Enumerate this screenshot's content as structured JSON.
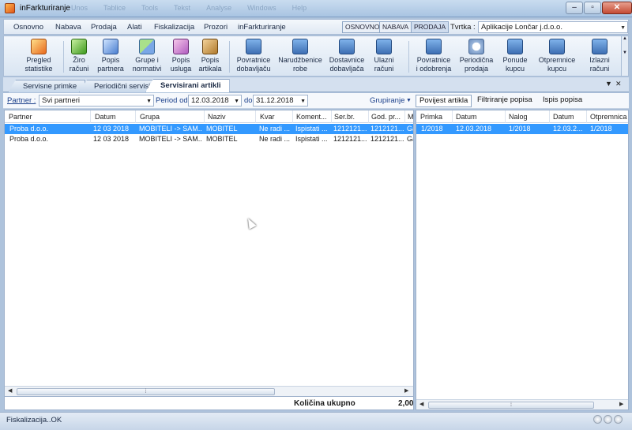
{
  "window": {
    "title": "inFarkturiranje",
    "ghost_menu": [
      "Unos",
      "Tablice",
      "Tools",
      "Tekst",
      "Analyse",
      "Windows",
      "Help"
    ],
    "minimize": "–",
    "maximize": "▫",
    "close": "✕"
  },
  "menu": {
    "items": [
      "Osnovno",
      "Nabava",
      "Prodaja",
      "Alati",
      "Fiskalizacija",
      "Prozori",
      "inFarkturiranje"
    ],
    "modes": [
      "OSNOVNO",
      "NABAVA",
      "PRODAJA"
    ],
    "tvrtka_label": "Tvrtka :",
    "tvrtka_value": "Aplikacije Lončar j.d.o.o."
  },
  "ribbon": {
    "buttons": [
      {
        "line1": "Pregled",
        "line2": "statistike",
        "icon": "chart-icon"
      },
      {
        "line1": "Žiro",
        "line2": "računi",
        "icon": "bank-icon"
      },
      {
        "line1": "Popis",
        "line2": "partnera",
        "icon": "partners-icon"
      },
      {
        "line1": "Grupe i",
        "line2": "normativi",
        "icon": "groups-icon"
      },
      {
        "line1": "Popis",
        "line2": "usluga",
        "icon": "services-icon"
      },
      {
        "line1": "Popis",
        "line2": "artikala",
        "icon": "box-icon"
      },
      {
        "line1": "Povratnice",
        "line2": "dobavljaču",
        "icon": "truck-return-icon"
      },
      {
        "line1": "Narudžbenice",
        "line2": "robe",
        "icon": "truck-order-icon"
      },
      {
        "line1": "Dostavnice",
        "line2": "dobavljača",
        "icon": "truck-delivery-icon"
      },
      {
        "line1": "Ulazni",
        "line2": "računi",
        "icon": "truck-invoice-icon"
      },
      {
        "line1": "Povratnice",
        "line2": "i odobrenja",
        "icon": "truck-credit-icon"
      },
      {
        "line1": "Periodična",
        "line2": "prodaja",
        "icon": "clock-icon"
      },
      {
        "line1": "Ponude",
        "line2": "kupcu",
        "icon": "truck-offer-icon"
      },
      {
        "line1": "Otpremnice",
        "line2": "kupcu",
        "icon": "truck-dispatch-icon"
      },
      {
        "line1": "Izlazni",
        "line2": "računi",
        "icon": "truck-outinvoice-icon"
      }
    ]
  },
  "tabs": [
    "Servisne primke",
    "Periodični servisi",
    "Servisirani artikli"
  ],
  "filter": {
    "partner_label": "Partner :",
    "partner_value": "Svi partneri",
    "period_label": "Period od",
    "date_from": "12.03.2018",
    "do_label": "do",
    "date_to": "31.12.2018",
    "group_label": "Grupiranje",
    "history_btn": "Povijest artikla",
    "filter_btn": "Filtriranje popisa",
    "print_btn": "Ispis popisa"
  },
  "left_table": {
    "columns": [
      "Partner",
      "Datum",
      "Grupa",
      "Naziv",
      "Kvar",
      "Koment...",
      "Ser.br.",
      "God. pr...",
      "M"
    ],
    "rows": [
      [
        "Proba d.o.o.",
        "12 03 2018",
        "MOBITELI -> SAM...",
        "MOBITEL",
        "Ne radi ...",
        "Ispistati ...",
        "1212121...",
        "1212121...",
        "Ga"
      ],
      [
        "Proba d.o.o.",
        "12 03 2018",
        "MOBITELI -> SAM...",
        "MOBITEL",
        "Ne radi ...",
        "Ispistati ...",
        "1212121...",
        "1212121...",
        "Ga"
      ]
    ],
    "total_label": "Količina ukupno",
    "total_value": "2,00"
  },
  "right_table": {
    "columns": [
      "Primka",
      "Datum",
      "Nalog",
      "Datum",
      "Otpremnica"
    ],
    "rows": [
      [
        "1/2018",
        "12.03.2018",
        "1/2018",
        "12.03.2...",
        "1/2018"
      ]
    ]
  },
  "status": {
    "text": "Fiskalizacija..OK"
  }
}
